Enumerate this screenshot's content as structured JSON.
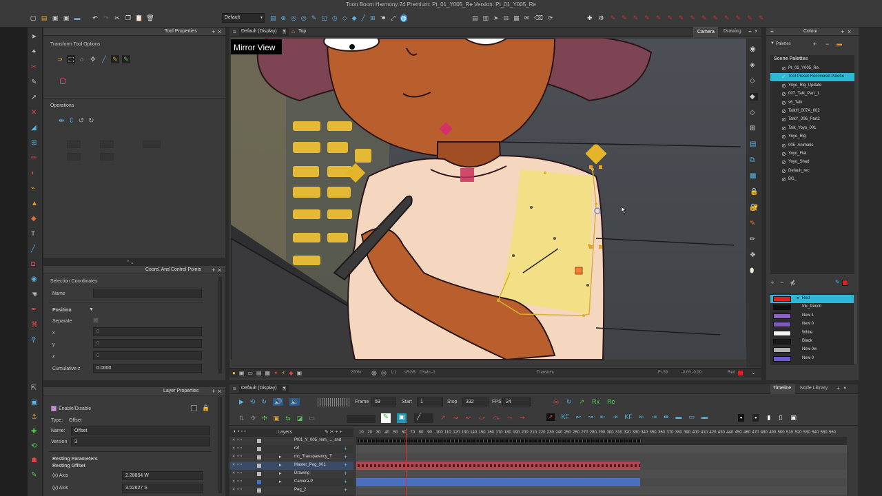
{
  "app": {
    "title": "Toon Boom Harmony 24 Premium: Pt_01_Y005_Re Version: Pt_01_Y005_Re",
    "workspace_select": "Default"
  },
  "tool_properties": {
    "title": "Tool Properties",
    "transform_options": "Transform Tool Options",
    "operations": "Operations"
  },
  "viewport": {
    "view_select": "Default (Display)",
    "breadcrumb": "Top",
    "tabs": [
      "Camera",
      "Drawing"
    ],
    "mirror_label": "Mirror View",
    "status": {
      "zoom": "200%",
      "scale": "1:1",
      "color_space": "sRGB",
      "chain": "Chain -1",
      "layer": "Translum",
      "frame": "Fr 59",
      "coords": "-0.00 -0.00",
      "color": "Red"
    }
  },
  "colour": {
    "title": "Colour",
    "palettes_label": "Palettes",
    "scene_palettes": "Scene Palettes",
    "palettes": [
      "Pt_02_Y005_Re",
      "Tool Preset Recovered Palette",
      "Yoyo_Rig_Update",
      "007_Talk_Part_1",
      "s6_Talk",
      "TalkH_007A_002",
      "TalkY_006_Part2",
      "Talk_Yoyo_001",
      "Yoyo_Rig",
      "005_Animatic",
      "Yoyo_Flat",
      "Yoyo_Shad",
      "Default_rec",
      "BG_"
    ],
    "swatches": [
      {
        "name": "Red",
        "color": "#e02020"
      },
      {
        "name": "Ink_Pencil",
        "color": "#111111"
      },
      {
        "name": "New 1",
        "color": "#8a62c6"
      },
      {
        "name": "New 0",
        "color": "#7a5cb8"
      },
      {
        "name": "White",
        "color": "#f4f4f4"
      },
      {
        "name": "Black",
        "color": "#1a1a1a"
      },
      {
        "name": "New 0w",
        "color": "#b0b0b0"
      },
      {
        "name": "New 0",
        "color": "#6c5bd0"
      }
    ]
  },
  "coord": {
    "title": "Coord. And Control Points",
    "selection_coordinates": "Selection Coordinates",
    "name_label": "Name",
    "position_label": "Position",
    "separate_label": "Separate",
    "x_label": "x",
    "y_label": "y",
    "z_label": "z",
    "x_val": "0",
    "y_val": "0",
    "z_val": "0",
    "cumulative_label": "Cumulative z",
    "cumulative_val": "0.0000"
  },
  "layer_props": {
    "title": "Layer Properties",
    "enable_label": "Enable/Disable",
    "type_label": "Type:",
    "type_val": "Offset",
    "name_label": "Name:",
    "name_val": "Offset",
    "version_label": "Version",
    "version_val": "3",
    "resting_parameters": "Resting Parameters",
    "resting_offset": "Resting Offset",
    "x_axis_label": "(x) Axis",
    "x_axis_val": "2.28854 W",
    "y_axis_label": "(y) Axis",
    "y_axis_val": "3.52627 S"
  },
  "timeline": {
    "view_select": "Default (Display)",
    "tabs": [
      "Timeline",
      "Node Library"
    ],
    "frame_label": "Frame",
    "frame_val": "59",
    "start_label": "Start",
    "start_val": "1",
    "stop_label": "Stop",
    "stop_val": "332",
    "fps_label": "FPS",
    "fps_val": "24",
    "layers_label": "Layers",
    "layers": [
      {
        "name": "Pt01_Y_005_rem_..._snd",
        "color": "#b9b9b9"
      },
      {
        "name": "ref",
        "color": "#b9b9b9"
      },
      {
        "name": "mc_Transparency_T",
        "color": "#b9b9b9"
      },
      {
        "name": "Master_Peg_001",
        "color": "#b9b9b9"
      },
      {
        "name": "Drawing",
        "color": "#b9b9b9"
      },
      {
        "name": "Camera-P",
        "color": "#3f72c9"
      },
      {
        "name": "Peg_2",
        "color": "#b9b9b9"
      }
    ],
    "ruler": [
      "10",
      "20",
      "30",
      "40",
      "50",
      "60",
      "70",
      "80",
      "90",
      "100",
      "110",
      "120",
      "130",
      "140",
      "150",
      "160",
      "170",
      "180",
      "190",
      "200",
      "210",
      "220",
      "230",
      "240",
      "250",
      "260",
      "270",
      "280",
      "290",
      "300",
      "310",
      "320",
      "330",
      "340",
      "350",
      "360",
      "370",
      "380",
      "390",
      "400",
      "410",
      "420",
      "430",
      "440",
      "450",
      "460",
      "470",
      "480",
      "490",
      "500",
      "510",
      "520",
      "530",
      "540",
      "550",
      "560"
    ]
  }
}
